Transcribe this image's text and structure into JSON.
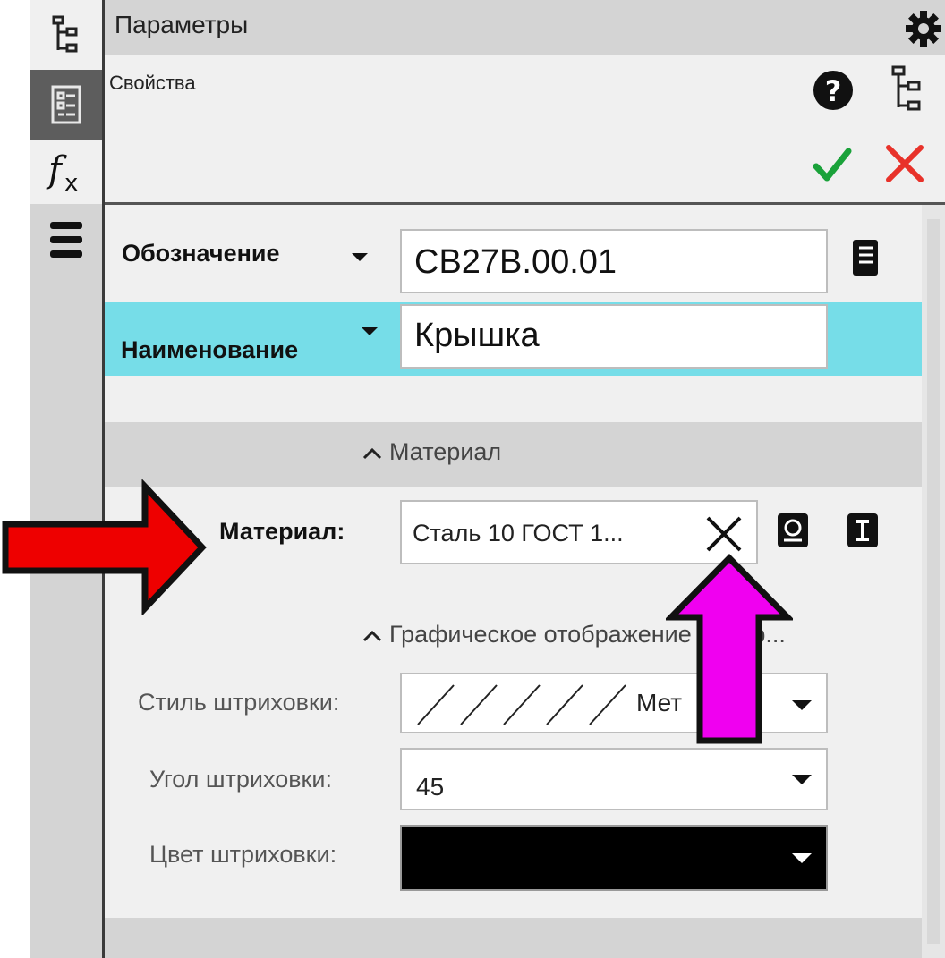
{
  "header": {
    "title": "Параметры",
    "properties_label": "Свойства"
  },
  "fields": {
    "designation_label": "Обозначение",
    "designation_value": "СВ27В.00.01",
    "name_label": "Наименование",
    "name_value": "Крышка"
  },
  "material_section": {
    "header": "Материал",
    "material_label": "Материал:",
    "material_value": "Сталь 10  ГОСТ 1..."
  },
  "graphic_section": {
    "header": "Графическое отображение матер...",
    "hatch_style_label": "Стиль штриховки:",
    "hatch_style_value": "Мет",
    "hatch_angle_label": "Угол штриховки:",
    "hatch_angle_value": "45",
    "hatch_color_label": "Цвет штриховки:",
    "hatch_color_value": "#000000"
  },
  "colors": {
    "highlight": "#76dde8",
    "accept": "#1aa23a",
    "cancel": "#e8322a",
    "red_arrow": "#ee0000",
    "magenta_arrow": "#f000f0"
  }
}
